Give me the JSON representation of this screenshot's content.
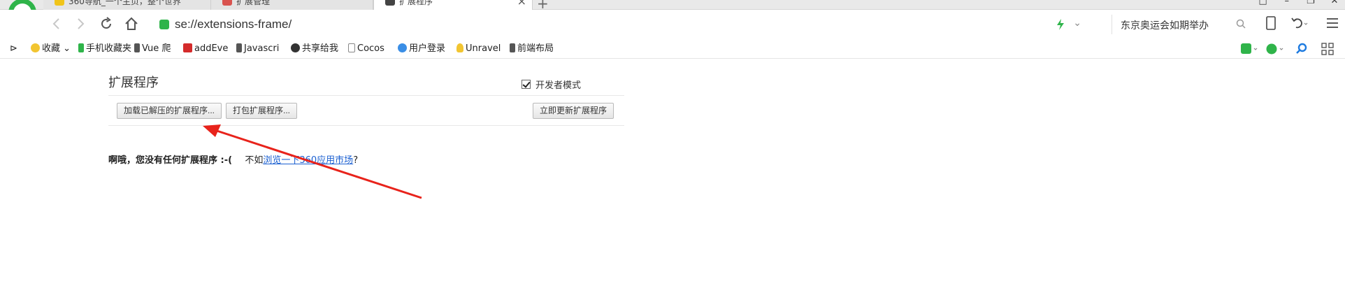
{
  "tabs": [
    {
      "label": "360导航_一个主页，整个世界",
      "active": false
    },
    {
      "label": "扩展管理",
      "active": false
    },
    {
      "label": "扩展程序",
      "active": true
    }
  ],
  "address": {
    "url": "se://extensions-frame/"
  },
  "search": {
    "query": "东京奥运会如期举办"
  },
  "bookmarks": [
    {
      "label": "收藏",
      "icon": "star-icon"
    },
    {
      "label": "手机收藏夹",
      "icon": "phone-icon"
    },
    {
      "label": "Vue 爬",
      "icon": "vue-icon"
    },
    {
      "label": "addEve",
      "icon": "addeve-icon"
    },
    {
      "label": "Javascri",
      "icon": "vue-icon"
    },
    {
      "label": "共享给我",
      "icon": "share-icon"
    },
    {
      "label": "Cocos",
      "icon": "page-icon"
    },
    {
      "label": "用户登录",
      "icon": "globe-icon"
    },
    {
      "label": "Unravel",
      "icon": "bulb-icon"
    },
    {
      "label": "前端布局",
      "icon": "vue-icon"
    }
  ],
  "page": {
    "title": "扩展程序",
    "developer_mode_label": "开发者模式",
    "developer_mode_checked": true,
    "load_unpacked_label": "加载已解压的扩展程序...",
    "pack_label": "打包扩展程序...",
    "update_now_label": "立即更新扩展程序",
    "empty_text": "啊哦，您没有任何扩展程序 :-(",
    "suggest_prefix": "不如",
    "suggest_link": "浏览一下360应用市场",
    "suggest_suffix": "?"
  },
  "colors": {
    "accent_green": "#2fb44a",
    "link_blue": "#1a5fd1",
    "arrow_red": "#e8231b"
  }
}
